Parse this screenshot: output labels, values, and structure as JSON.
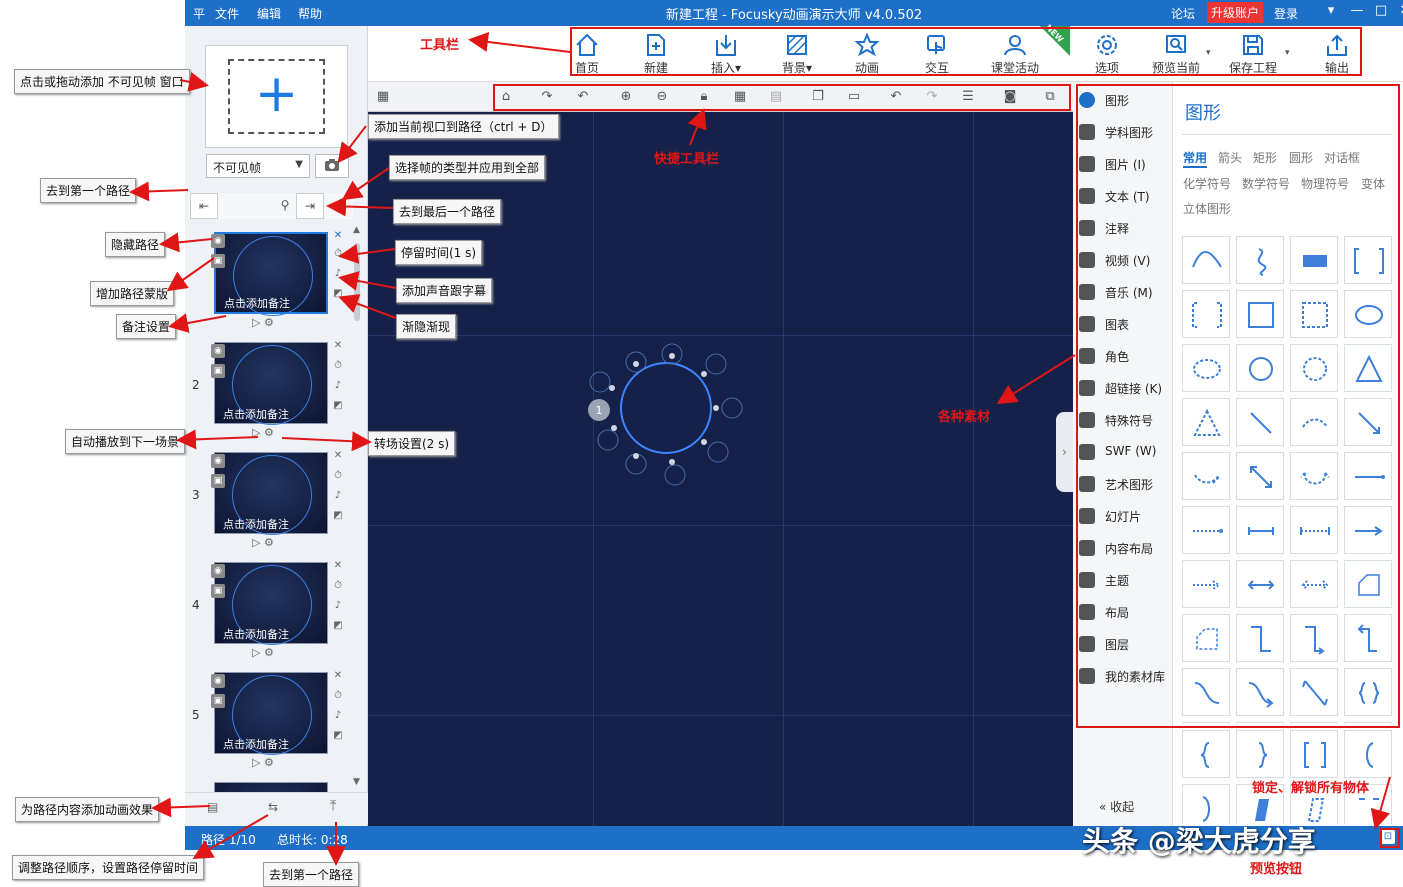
{
  "titlebar": {
    "menu_icon": "平",
    "menu": [
      "文件",
      "编辑",
      "帮助"
    ],
    "title": "新建工程 - Focusky动画演示大师  v4.0.502",
    "right": [
      "论坛",
      "升级账户",
      "登录"
    ]
  },
  "toolbar": [
    {
      "icon": "home-icon",
      "label": "首页"
    },
    {
      "icon": "new-icon",
      "label": "新建"
    },
    {
      "icon": "insert-icon",
      "label": "插入▾"
    },
    {
      "icon": "background-icon",
      "label": "背景▾"
    },
    {
      "icon": "animation-icon",
      "label": "动画"
    },
    {
      "icon": "interact-icon",
      "label": "交互"
    },
    {
      "icon": "classroom-icon",
      "label": "课堂活动",
      "badge": "NEW"
    },
    {
      "icon": "settings-icon",
      "label": "选项"
    },
    {
      "icon": "preview-icon",
      "label": "预览当前"
    },
    {
      "icon": "save-icon",
      "label": "保存工程"
    },
    {
      "icon": "export-icon",
      "label": "输出"
    }
  ],
  "left": {
    "frame_type": "不可见帧",
    "slides": [
      {
        "num": "",
        "note": "点击添加备注"
      },
      {
        "num": "2",
        "note": "点击添加备注"
      },
      {
        "num": "3",
        "note": "点击添加备注"
      },
      {
        "num": "4",
        "note": "点击添加备注"
      },
      {
        "num": "5",
        "note": "点击添加备注"
      }
    ]
  },
  "status": {
    "path": "路径 1/10",
    "total": "总时长: 0:28"
  },
  "categories": [
    {
      "icon": "shape-icon",
      "label": "图形"
    },
    {
      "icon": "subject-shape-icon",
      "label": "学科图形"
    },
    {
      "icon": "image-icon",
      "label": "图片 (I)"
    },
    {
      "icon": "text-icon",
      "label": "文本 (T)"
    },
    {
      "icon": "comment-icon",
      "label": "注释"
    },
    {
      "icon": "video-icon",
      "label": "视频 (V)"
    },
    {
      "icon": "music-icon",
      "label": "音乐 (M)"
    },
    {
      "icon": "chart-icon",
      "label": "图表"
    },
    {
      "icon": "role-icon",
      "label": "角色"
    },
    {
      "icon": "link-icon",
      "label": "超链接 (K)"
    },
    {
      "icon": "symbol-icon",
      "label": "特殊符号"
    },
    {
      "icon": "swf-icon",
      "label": "SWF (W)"
    },
    {
      "icon": "art-shape-icon",
      "label": "艺术图形"
    },
    {
      "icon": "slide-icon",
      "label": "幻灯片"
    },
    {
      "icon": "layout-icon",
      "label": "内容布局"
    },
    {
      "icon": "theme-icon",
      "label": "主题"
    },
    {
      "icon": "arrange-icon",
      "label": "布局"
    },
    {
      "icon": "layer-icon",
      "label": "图层"
    },
    {
      "icon": "library-icon",
      "label": "我的素材库"
    }
  ],
  "collapse": "收起",
  "shapes": {
    "title": "图形",
    "tabs1": [
      "常用",
      "箭头",
      "矩形",
      "圆形",
      "对话框"
    ],
    "tabs2": [
      "化学符号",
      "数学符号",
      "物理符号",
      "变体"
    ],
    "tabs3": [
      "立体图形"
    ]
  },
  "annotations": {
    "toolbar": "工具栏",
    "quickbar": "快捷工具栏",
    "materials": "各种素材",
    "lock": "锁定、解锁所有物体",
    "preview_btn": "预览按钮",
    "add_invisible": "点击或拖动添加 不可见帧 窗口",
    "add_view": "添加当前视口到路径（ctrl + D）",
    "frame_type": "选择帧的类型并应用到全部",
    "first_path": "去到第一个路径",
    "last_path": "去到最后一个路径",
    "hide_path": "隐藏路径",
    "stay": "停留时间(1 s)",
    "mask": "增加路径蒙版",
    "sound": "添加声音跟字幕",
    "note": "备注设置",
    "fade": "渐隐渐现",
    "autoplay": "自动播放到下一场景",
    "transition": "转场设置(2 s)",
    "anim_effect": "为路径内容添加动画效果",
    "reorder": "调整路径顺序，设置路径停留时间",
    "first_path2": "去到第一个路径"
  },
  "watermark": "头条 @梁大虎分享",
  "colors": {
    "accent": "#1e6fc8",
    "canvas": "#16214a",
    "annotation": "#e01616"
  }
}
